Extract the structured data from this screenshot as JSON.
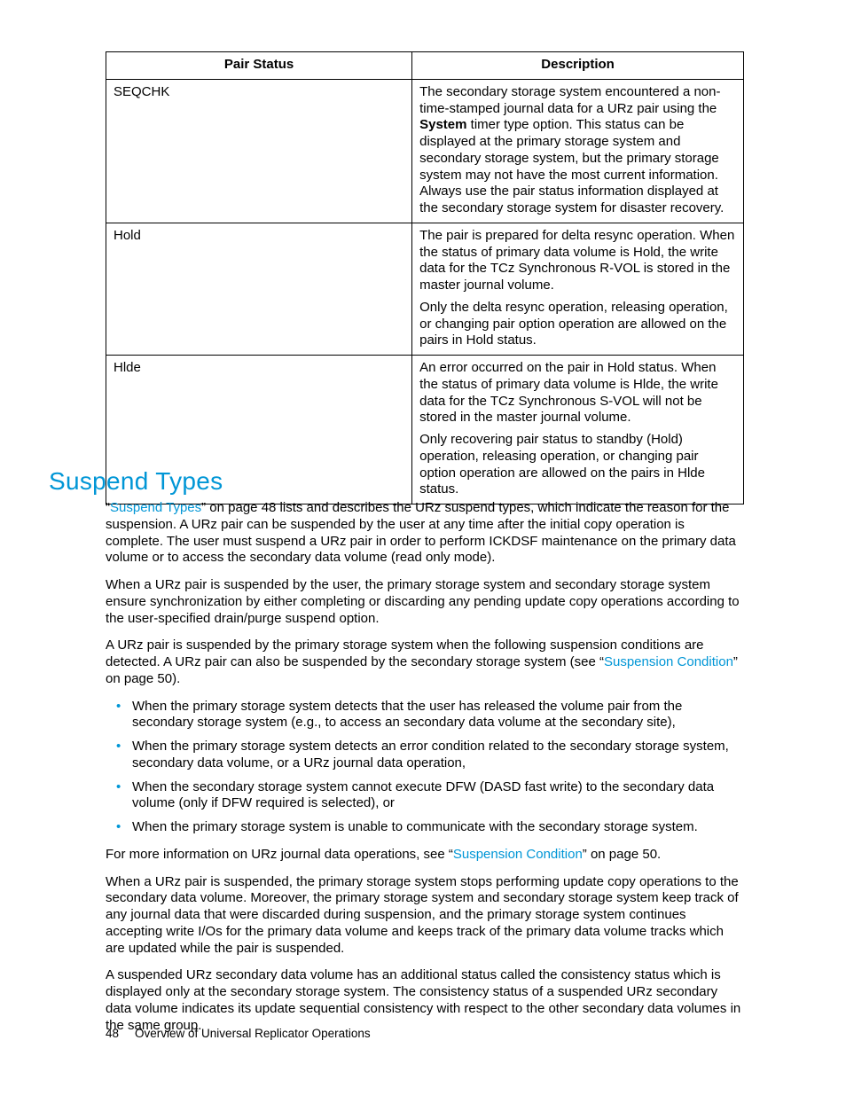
{
  "table": {
    "headers": {
      "col1": "Pair Status",
      "col2": "Description"
    },
    "rows": [
      {
        "status": "SEQCHK",
        "desc": [
          "The secondary storage system encountered a non-time-stamped journal data for a URz pair using the <b>System</b> timer type option. This status can be displayed at the primary storage system and secondary storage system, but the primary storage system may not have the most current information. Always use the pair status information displayed at the secondary storage system for disaster recovery."
        ]
      },
      {
        "status": "Hold",
        "desc": [
          "The pair is prepared for delta resync operation. When the status of primary data volume is Hold, the write data for the TCz Synchronous R-VOL is stored in the master journal volume.",
          "Only the delta resync operation, releasing operation, or changing pair option operation are allowed on the pairs in Hold status."
        ]
      },
      {
        "status": "Hlde",
        "desc": [
          "An error occurred on the pair in Hold status. When the status of primary data volume is Hlde, the write data for the TCz Synchronous S-VOL will not be stored in the master journal volume.",
          "Only recovering pair status to standby (Hold) operation, releasing operation, or changing pair option operation are allowed on the pairs in Hlde status."
        ]
      }
    ]
  },
  "heading": "Suspend Types",
  "paras": {
    "p1_pre": "“",
    "p1_link": "Suspend Types",
    "p1_post": "” on page 48 lists and describes the URz suspend types, which indicate the reason for the suspension. A URz pair can be suspended by the user at any time after the initial copy operation is complete. The user must suspend a URz pair in order to perform ICKDSF maintenance on the primary data volume or to access the secondary data volume (read only mode).",
    "p2": "When a URz pair is suspended by the user, the primary storage system and secondary storage system ensure synchronization by either completing or discarding any pending update copy operations according to the user-specified drain/purge suspend option.",
    "p3_pre": "A URz pair is suspended by the primary storage system when the following suspension conditions are detected. A URz pair can also be suspended by the secondary storage system (see “",
    "p3_link": "Suspension Condition",
    "p3_post": "” on page 50).",
    "p4_pre": "For more information on URz journal data operations, see “",
    "p4_link": "Suspension Condition",
    "p4_post": "” on page 50.",
    "p5": "When a URz pair is suspended, the primary storage system stops performing update copy operations to the secondary data volume. Moreover, the primary storage system and secondary storage system keep track of any journal data that were discarded during suspension, and the primary storage system continues accepting write I/Os for the primary data volume and keeps track of the primary data volume tracks which are updated while the pair is suspended.",
    "p6": "A suspended URz secondary data volume has an additional status called the consistency status which is displayed only at the secondary storage system. The consistency status of a suspended URz secondary data volume indicates its update sequential consistency with respect to the other secondary data volumes in the same group."
  },
  "bullets": [
    "When the primary storage system detects that the user has released the volume pair from the secondary storage system (e.g., to access an secondary data volume at the secondary site),",
    "When the primary storage system detects an error condition related to the secondary storage system, secondary data volume, or a URz journal data operation,",
    "When the secondary storage system cannot execute DFW (DASD fast write) to the secondary data volume (only if DFW required is selected), or",
    "When the primary storage system is unable to communicate with the secondary storage system."
  ],
  "footer": {
    "page": "48",
    "title": "Overview of Universal Replicator Operations"
  }
}
